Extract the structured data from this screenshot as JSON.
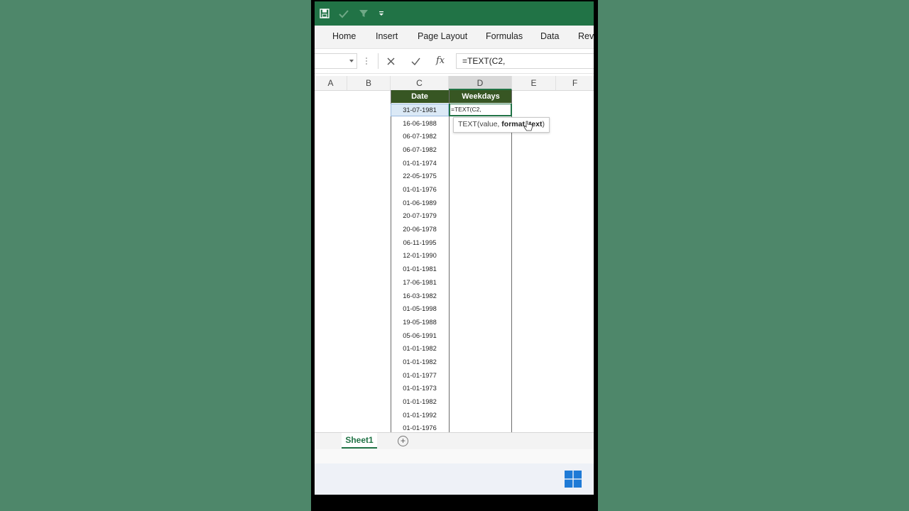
{
  "ribbon": {
    "tabs": [
      "Home",
      "Insert",
      "Page Layout",
      "Formulas",
      "Data",
      "Rev"
    ]
  },
  "formula_bar": {
    "name_box": "",
    "fx_label": "fx",
    "formula": "=TEXT(C2,"
  },
  "columns": [
    "A",
    "B",
    "C",
    "D",
    "E",
    "F"
  ],
  "table": {
    "header_date": "Date",
    "header_weekdays": "Weekdays",
    "editing_cell": "=TEXT(C2,",
    "dates": [
      "31-07-1981",
      "16-06-1988",
      "06-07-1982",
      "06-07-1982",
      "01-01-1974",
      "22-05-1975",
      "01-01-1976",
      "01-06-1989",
      "20-07-1979",
      "20-06-1978",
      "06-11-1995",
      "12-01-1990",
      "01-01-1981",
      "17-06-1981",
      "16-03-1982",
      "01-05-1998",
      "19-05-1988",
      "05-06-1991",
      "01-01-1982",
      "01-01-1982",
      "01-01-1977",
      "01-01-1973",
      "01-01-1982",
      "01-01-1992",
      "01-01-1976"
    ]
  },
  "tooltip": {
    "func": "TEXT(value, ",
    "current_arg": "format_text",
    "close": ")"
  },
  "sheets": {
    "active": "Sheet1",
    "add": "+"
  },
  "colors": {
    "title_bar": "#217346",
    "header_fill": "#375623",
    "background": "#4e876a"
  }
}
